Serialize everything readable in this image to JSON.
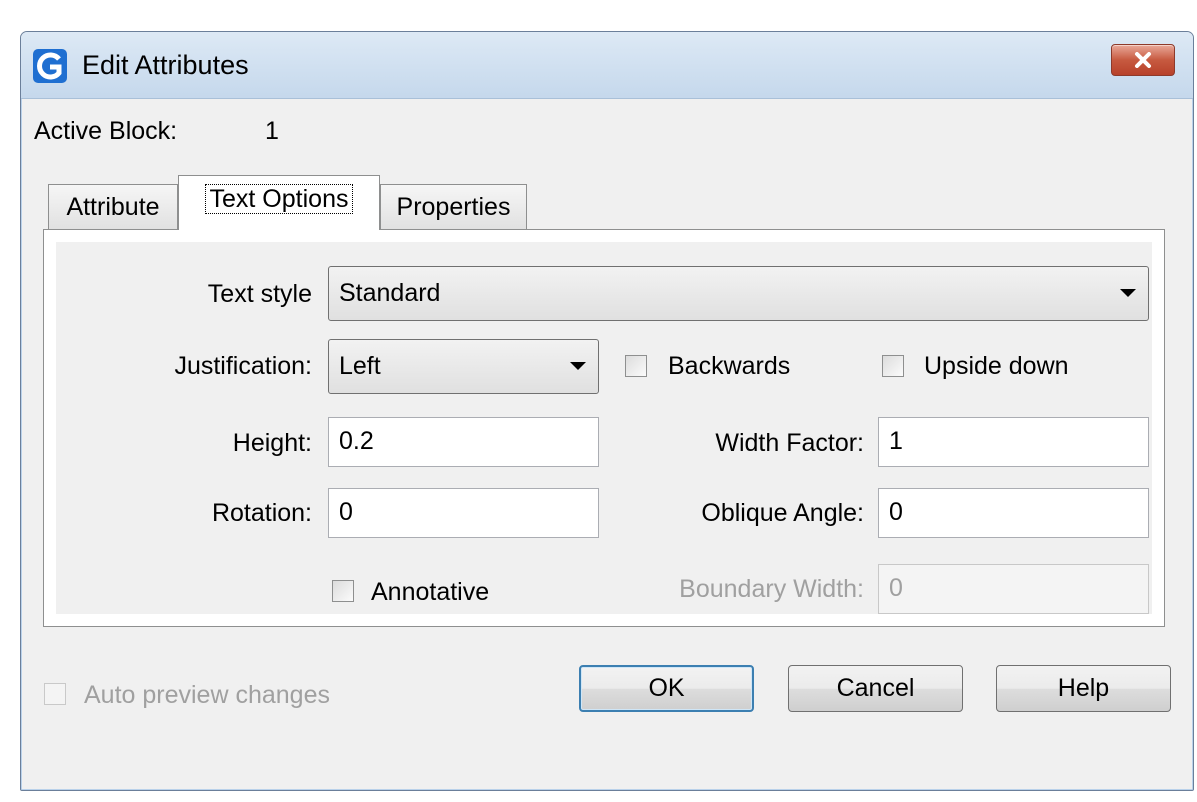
{
  "window": {
    "title": "Edit Attributes"
  },
  "active_block": {
    "label": "Active Block:",
    "value": "1"
  },
  "tabs": [
    {
      "label": "Attribute"
    },
    {
      "label": "Text Options"
    },
    {
      "label": "Properties"
    }
  ],
  "text_options": {
    "text_style": {
      "label": "Text style",
      "value": "Standard"
    },
    "justification": {
      "label": "Justification:",
      "value": "Left"
    },
    "backwards": {
      "label": "Backwards",
      "checked": false
    },
    "upside_down": {
      "label": "Upside down",
      "checked": false
    },
    "height": {
      "label": "Height:",
      "value": "0.2"
    },
    "width_factor": {
      "label": "Width Factor:",
      "value": "1"
    },
    "rotation": {
      "label": "Rotation:",
      "value": "0"
    },
    "oblique_angle": {
      "label": "Oblique Angle:",
      "value": "0"
    },
    "annotative": {
      "label": "Annotative",
      "checked": false
    },
    "boundary_width": {
      "label": "Boundary Width:",
      "value": "0"
    }
  },
  "auto_preview": {
    "label": "Auto preview changes"
  },
  "buttons": {
    "ok": "OK",
    "cancel": "Cancel",
    "help": "Help"
  },
  "colors": {
    "titlebar": "#c5d8ec",
    "close": "#c75a40",
    "default_button_border": "#3c7fb1"
  },
  "icons": {
    "app": "app-logo-icon",
    "close": "close-icon"
  }
}
